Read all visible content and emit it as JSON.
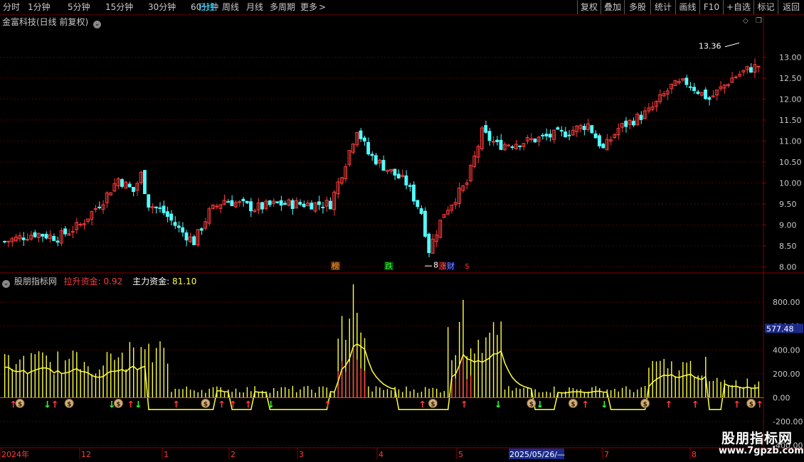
{
  "toolbar": {
    "periods": [
      "分时",
      "1分钟",
      "5分钟",
      "15分钟",
      "30分钟",
      "60分钟",
      "日线",
      "周线",
      "月线",
      "多周期",
      "更多"
    ],
    "active_period": "日线",
    "more_arrow": ">",
    "right_buttons": [
      "复权",
      "叠加",
      "多股",
      "统计",
      "画线",
      "F10",
      "+自选",
      "标记",
      "返回"
    ]
  },
  "stock": {
    "title": "金富科技(日线 前复权)",
    "title_btn": "⌄"
  },
  "price_axis": {
    "ticks": [
      "13.00",
      "12.50",
      "12.00",
      "11.50",
      "11.00",
      "10.50",
      "10.00",
      "9.50",
      "9.00",
      "8.50",
      "8.00"
    ],
    "tick_values": [
      13.0,
      12.5,
      12.0,
      11.5,
      11.0,
      10.5,
      10.0,
      9.5,
      9.0,
      8.5,
      8.0
    ],
    "range": [
      7.87,
      13.72
    ],
    "high_label": "13.36",
    "low_label": "8.05"
  },
  "markers": [
    {
      "text": "榜",
      "color": "#ff9040",
      "bg": "#5a3000"
    },
    {
      "text": "跌",
      "color": "#40ff40",
      "bg": "#004000"
    },
    {
      "text": "涨",
      "color": "#ff6060",
      "bg": "#400000"
    },
    {
      "text": "财",
      "color": "#80a0ff",
      "bg": "#000040"
    },
    {
      "text": "$",
      "color": "#ff2020",
      "bg": "#000000"
    }
  ],
  "indicator": {
    "name": "股朋指标网",
    "lashen_label": "拉升资金:",
    "lashen_value": "0.92",
    "zhuli_label": "主力资金:",
    "zhuli_value": "81.10",
    "axis_ticks": [
      "800.00",
      "600.00",
      "400.00",
      "200.00",
      "0.00",
      "-200.00",
      "-400.00"
    ],
    "axis_values": [
      800,
      600,
      400,
      200,
      0,
      -200,
      -400
    ],
    "range": [
      -420,
      980
    ],
    "current_value": "577.48"
  },
  "date_axis": {
    "labels": [
      "2024年",
      "12",
      "1",
      "2",
      "3",
      "4",
      "5",
      "2025/05/26/—",
      "7",
      "8"
    ],
    "highlight": "2025/05/26/—"
  },
  "watermark": {
    "name": "股朋指标网",
    "url": "www.7gpzb.com"
  },
  "colors": {
    "up": "#ff3c3c",
    "down": "#54ffff",
    "grid": "#5a0000",
    "axis_text": "#c8c8c8",
    "indicator_bar": "#ffff40",
    "active": "#00c8ff"
  }
}
